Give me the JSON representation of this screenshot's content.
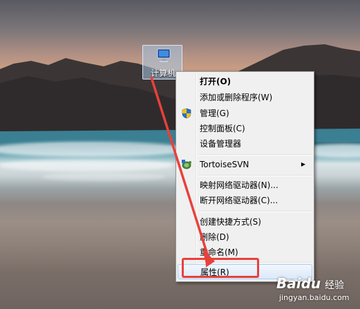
{
  "desktop_icon": {
    "label": "计算机"
  },
  "context_menu": {
    "items": [
      {
        "label": "打开(O)"
      },
      {
        "label": "添加或删除程序(W)"
      },
      {
        "label": "管理(G)"
      },
      {
        "label": "控制面板(C)"
      },
      {
        "label": "设备管理器"
      },
      {
        "label": "TortoiseSVN"
      },
      {
        "label": "映射网络驱动器(N)..."
      },
      {
        "label": "断开网络驱动器(C)..."
      },
      {
        "label": "创建快捷方式(S)"
      },
      {
        "label": "删除(D)"
      },
      {
        "label": "重命名(M)"
      },
      {
        "label": "属性(R)"
      }
    ]
  },
  "annotation": {
    "highlight_color": "#e8413b",
    "arrow_color": "#e8413b"
  },
  "watermark": {
    "brand": "Baidu",
    "sub": "经验",
    "url": "jingyan.baidu.com"
  }
}
